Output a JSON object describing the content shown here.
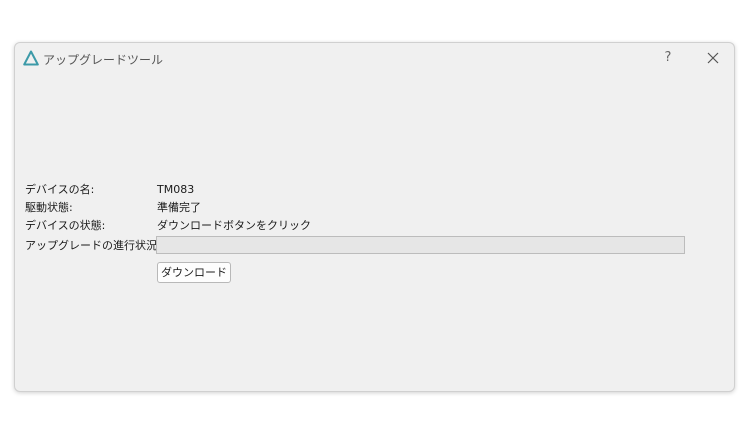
{
  "window": {
    "title": "アップグレードツール",
    "help_label": "?"
  },
  "fields": {
    "device_name_label": "デバイスの名:",
    "device_name_value": "TM083",
    "driver_status_label": "駆動状態:",
    "driver_status_value": "準備完了",
    "device_status_label": "デバイスの状態:",
    "device_status_value": "ダウンロードボタンをクリック",
    "progress_label": "アップグレードの進行状況:"
  },
  "progress": {
    "value_percent": 0
  },
  "actions": {
    "download_label": "ダウンロード"
  },
  "colors": {
    "icon_accent": "#3c9aa8",
    "window_bg": "#f0f0f0",
    "progress_bg": "#e6e6e6"
  },
  "icons": {
    "app": "triangle-logo-icon",
    "close": "close-icon"
  }
}
